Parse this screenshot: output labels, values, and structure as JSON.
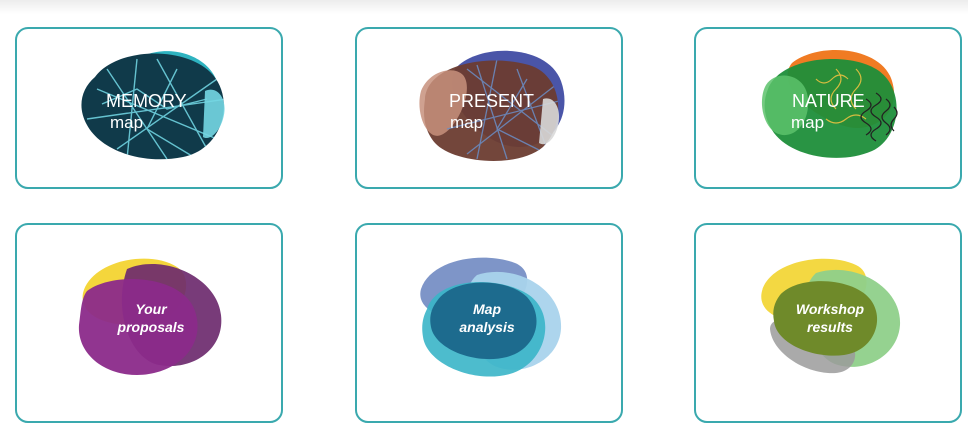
{
  "cards": [
    {
      "title": "MEMORY",
      "subtitle": "map",
      "colors": {
        "primary": "#103a4a",
        "secondary": "#2eb3c0",
        "accent": "#74d7e3"
      }
    },
    {
      "title": "PRESENT",
      "subtitle": "map",
      "colors": {
        "primary": "#6b3c30",
        "secondary": "#4a55a8",
        "accent": "#c7907c"
      }
    },
    {
      "title": "NATURE",
      "subtitle": "map",
      "colors": {
        "primary": "#1e8e3a",
        "secondary": "#f07b23",
        "accent": "#5cc26b"
      }
    },
    {
      "line1": "Your",
      "line2": "proposals",
      "colors": {
        "primary": "#8b2a8a",
        "secondary": "#f4d63c",
        "accent": "#6d2a6e"
      }
    },
    {
      "line1": "Map",
      "line2": "analysis",
      "colors": {
        "primary": "#1d6b8e",
        "secondary": "#7e95c8",
        "accent": "#3ab5c8"
      }
    },
    {
      "line1": "Workshop",
      "line2": "results",
      "colors": {
        "primary": "#6f8a2a",
        "secondary": "#f3d842",
        "accent": "#8fd08a"
      }
    }
  ]
}
